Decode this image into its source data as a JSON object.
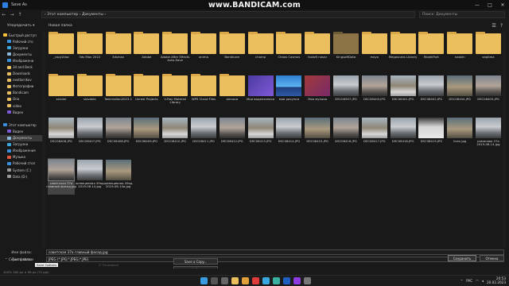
{
  "window": {
    "title": "Save As",
    "controls": [
      "—",
      "□",
      "✕"
    ]
  },
  "watermark": "www.BANDICAM.com",
  "address": {
    "path": "›  Этот компьютер  ›  Документы  ›",
    "search_placeholder": "Поиск: Документы"
  },
  "toolbar": {
    "organize": "Упорядочить ▾",
    "new_folder": "Новая папка",
    "right_icons": [
      "☰",
      "?"
    ]
  },
  "sidebar": {
    "items": [
      {
        "label": "Быстрый доступ",
        "icon": "star-icon",
        "color": "#f3c33b",
        "selected": false
      },
      {
        "label": "Рабочий сто",
        "icon": "desktop-icon",
        "color": "#3b8fe0",
        "selected": false
      },
      {
        "label": "Загрузки",
        "icon": "download-icon",
        "color": "#3ba7e0",
        "selected": false
      },
      {
        "label": "Документы",
        "icon": "document-icon",
        "color": "#8fb8e0",
        "selected": false
      },
      {
        "label": "Изображени",
        "icon": "pictures-icon",
        "color": "#3b8fe0",
        "selected": false
      },
      {
        "label": "3d and Beck",
        "icon": "folder-icon",
        "color": "#ecbf5e",
        "selected": false
      },
      {
        "label": "Downloads",
        "icon": "folder-icon",
        "color": "#ecbf5e",
        "selected": false
      },
      {
        "label": "nextlorrikov",
        "icon": "folder-icon",
        "color": "#ecbf5e",
        "selected": false
      },
      {
        "label": "Фотографии",
        "icon": "folder-icon",
        "color": "#ecbf5e",
        "selected": false
      },
      {
        "label": "Bandicam",
        "icon": "folder-icon",
        "color": "#ecbf5e",
        "selected": false
      },
      {
        "label": "Ona",
        "icon": "folder-icon",
        "color": "#ecbf5e",
        "selected": false
      },
      {
        "label": "video",
        "icon": "folder-icon",
        "color": "#ecbf5e",
        "selected": false
      },
      {
        "label": "Видео",
        "icon": "video-icon",
        "color": "#7f5ad8",
        "selected": false
      },
      {
        "label": "",
        "icon": "",
        "color": "#191919",
        "selected": false
      },
      {
        "label": "Этот компьютер",
        "icon": "computer-icon",
        "color": "#3b8fe0",
        "selected": false
      },
      {
        "label": "Видео",
        "icon": "video-icon",
        "color": "#7f5ad8",
        "selected": false
      },
      {
        "label": "Документы",
        "icon": "document-icon",
        "color": "#8fb8e0",
        "selected": true
      },
      {
        "label": "Загрузки",
        "icon": "download-icon",
        "color": "#3ba7e0",
        "selected": false
      },
      {
        "label": "Изображения",
        "icon": "pictures-icon",
        "color": "#3b8fe0",
        "selected": false
      },
      {
        "label": "Музыка",
        "icon": "music-icon",
        "color": "#e05a3b",
        "selected": false
      },
      {
        "label": "Рабочий стол",
        "icon": "desktop-icon",
        "color": "#3b8fe0",
        "selected": false
      },
      {
        "label": "System (C:)",
        "icon": "drive-icon",
        "color": "#9a9a9a",
        "selected": false
      },
      {
        "label": "Data (D:)",
        "icon": "drive-icon",
        "color": "#9a9a9a",
        "selected": false
      }
    ]
  },
  "files": [
    {
      "label": "_copy2doc",
      "kind": "folder"
    },
    {
      "label": "3ds Max 2022",
      "kind": "folder"
    },
    {
      "label": "3dsmax",
      "kind": "folder"
    },
    {
      "label": "Adobe",
      "kind": "folder"
    },
    {
      "label": "Adobe After Effects Auto-Save",
      "kind": "folder"
    },
    {
      "label": "anima",
      "kind": "folder"
    },
    {
      "label": "Bandicam",
      "kind": "folder"
    },
    {
      "label": "champ",
      "kind": "folder"
    },
    {
      "label": "Chaos Cosmos",
      "kind": "folder"
    },
    {
      "label": "foxloft naxar",
      "kind": "folder"
    },
    {
      "label": "KingsoftData",
      "kind": "folder dark"
    },
    {
      "label": "maya",
      "kind": "folder"
    },
    {
      "label": "Megascans Library",
      "kind": "folder"
    },
    {
      "label": "ModelPort",
      "kind": "folder"
    },
    {
      "label": "nadzin",
      "kind": "folder"
    },
    {
      "label": "septima",
      "kind": "folder"
    },
    {
      "label": "sender",
      "kind": "folder"
    },
    {
      "label": "slovakia",
      "kind": "folder"
    },
    {
      "label": "Twinmotion2023.1",
      "kind": "folder"
    },
    {
      "label": "Unreal Projects",
      "kind": "folder"
    },
    {
      "label": "V-Ray Material Library",
      "kind": "folder"
    },
    {
      "label": "WPS Cloud Files",
      "kind": "folder"
    },
    {
      "label": "ансыки",
      "kind": "folder"
    },
    {
      "label": "Мои видеозаписи",
      "kind": "video"
    },
    {
      "label": "мои рисунки",
      "kind": "pictures"
    },
    {
      "label": "Моя музыка",
      "kind": "music"
    },
    {
      "label": "DSC08397.JPG",
      "kind": "photo"
    },
    {
      "label": "DSC08400.JPG",
      "kind": "photo b"
    },
    {
      "label": "DSC08401.JPG",
      "kind": "photo c"
    },
    {
      "label": "DSC08402.JPG",
      "kind": "photo"
    },
    {
      "label": "DSC08404.JPG",
      "kind": "photo e"
    },
    {
      "label": "DSC08405.JPG",
      "kind": "photo b"
    },
    {
      "label": "DSC08406.JPG",
      "kind": "photo c"
    },
    {
      "label": "DSC08407.JPG",
      "kind": "photo"
    },
    {
      "label": "DSC08408.JPG",
      "kind": "photo b"
    },
    {
      "label": "DSC08409.JPG",
      "kind": "photo e"
    },
    {
      "label": "DSC08410.JPG",
      "kind": "photo c"
    },
    {
      "label": "DSC08411.JPG",
      "kind": "photo"
    },
    {
      "label": "DSC08412.JPG",
      "kind": "photo b"
    },
    {
      "label": "DSC08413.JPG",
      "kind": "photo c"
    },
    {
      "label": "DSC08414.JPG",
      "kind": "photo"
    },
    {
      "label": "DSC08415.JPG",
      "kind": "photo e"
    },
    {
      "label": "DSC08416.JPG",
      "kind": "photo b"
    },
    {
      "label": "DSC08417.JPG",
      "kind": "photo c"
    },
    {
      "label": "DSC08418.JPG",
      "kind": "photo"
    },
    {
      "label": "DSC08419.JPG",
      "kind": "photo d"
    },
    {
      "label": "liven.jpg",
      "kind": "photo e"
    },
    {
      "label": "романова 37а 2019-06-14.jpg",
      "kind": "photo"
    },
    {
      "label": "советская 37а главный фасад.jpg",
      "kind": "photo b",
      "selected": true
    },
    {
      "label": "шевецивная 49ад 2019-06-14.jpg",
      "kind": "photo"
    },
    {
      "label": "шевецивная 49ад 2019-06-14a.jpg",
      "kind": "photo e"
    }
  ],
  "bottom": {
    "filename_label": "Имя файла:",
    "filename_value": "советская 37а главный фасад.jpg",
    "filetype_label": "Тип файла:",
    "filetype_value": "JPEG (*.JPG;*.JPEG;*.JPE)",
    "save_options": "Save Options",
    "opt_a": "As a Copy",
    "opt_b": "Thumbnail",
    "save_copy_button": "Save a Copy...",
    "info_button": "Info",
    "hide_folders": "⌃  Скрыть папки",
    "save_button": "Сохранить",
    "cancel_button": "Отмена"
  },
  "status": "100%    182 px × 99 px (72 ppi)",
  "taskbar": {
    "icons": [
      {
        "name": "windows-start-icon",
        "color": "#3b9be0"
      },
      {
        "name": "search-icon",
        "color": "#555"
      },
      {
        "name": "task-view-icon",
        "color": "#666"
      },
      {
        "name": "explorer-icon",
        "color": "#ecbf5e"
      },
      {
        "name": "chrome-icon",
        "color": "#e0a03b"
      },
      {
        "name": "yandex-icon",
        "color": "#e03b3b"
      },
      {
        "name": "telegram-icon",
        "color": "#3ba7e0"
      },
      {
        "name": "max-icon",
        "color": "#3bb0a0"
      },
      {
        "name": "photoshop-icon",
        "color": "#1f5fbf"
      },
      {
        "name": "bandicam-icon",
        "color": "#8b3be0"
      },
      {
        "name": "app-icon",
        "color": "#777"
      }
    ],
    "lang": "РУС",
    "time": "20:53",
    "date": "20.02.2023"
  }
}
